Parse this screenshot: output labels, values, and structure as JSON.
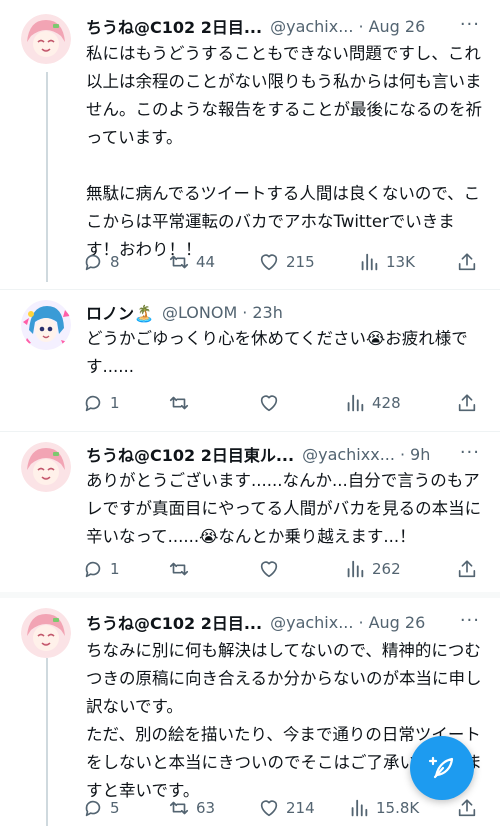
{
  "tweets": [
    {
      "name": "ちうね@C102 2日目...",
      "handle": "@yachix...",
      "time": "Aug 26",
      "text": "私にはもうどうすることもできない問題ですし、これ以上は余程のことがない限りもう私からは何も言いません。このような報告をすることが最後になるのを祈っています。\n\n無駄に病んでるツイートする人間は良くないので、ここからは平常運転のバカでアホなTwitterでいきます！おわり！！",
      "replies": "8",
      "retweets": "44",
      "likes": "215",
      "views": "13K"
    },
    {
      "name": "ロノン🏝️",
      "handle": "@LONOM",
      "time": "23h",
      "text": "どうかごゆっくり心を休めてください😭お疲れ様です......",
      "replies": "1",
      "retweets": "",
      "likes": "",
      "views": "428"
    },
    {
      "name": "ちうね@C102 2日目東ル...",
      "handle": "@yachixx...",
      "time": "9h",
      "text": "ありがとうございます......なんか...自分で言うのもアレですが真面目にやってる人間がバカを見るの本当に辛いなって......😭なんとか乗り越えます...！",
      "replies": "1",
      "retweets": "",
      "likes": "",
      "views": "262"
    },
    {
      "name": "ちうね@C102 2日目...",
      "handle": "@yachix...",
      "time": "Aug 26",
      "text": "ちなみに別に何も解決はしてないので、精神的につむつきの原稿に向き合えるか分からないのが本当に申し訳ないです。\nただ、別の絵を描いたり、今まで通りの日常ツイートをしないと本当にきついのでそこはご了承いただけますと幸いです。",
      "replies": "5",
      "retweets": "63",
      "likes": "214",
      "views": "15.8K"
    }
  ],
  "more_label": "···",
  "dot": "·",
  "colors": {
    "accent": "#1d9bf0",
    "secondary_text": "#536471",
    "thread_line": "#cfd9de"
  },
  "icons": [
    "reply-icon",
    "retweet-icon",
    "like-icon",
    "views-icon",
    "share-icon",
    "compose-icon"
  ]
}
